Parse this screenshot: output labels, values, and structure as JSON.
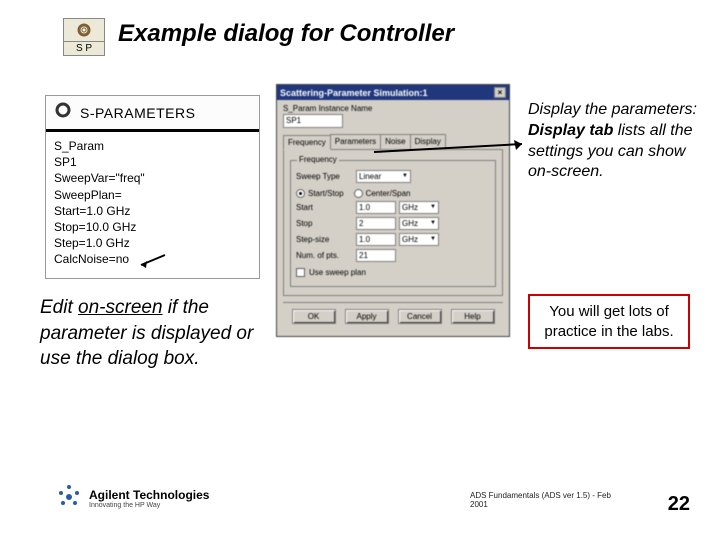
{
  "sp_icon": {
    "label": "S P"
  },
  "title": "Example dialog for Controller",
  "sparam_block": {
    "header": "S-PARAMETERS",
    "lines": [
      "S_Param",
      "SP1",
      "SweepVar=\"freq\"",
      "SweepPlan=",
      "Start=1.0 GHz",
      "Stop=10.0 GHz",
      "Step=1.0 GHz",
      "CalcNoise=no"
    ]
  },
  "dialog": {
    "title": "Scattering-Parameter Simulation:1",
    "instance_label": "S_Param Instance Name",
    "instance_value": "SP1",
    "tabs": [
      "Frequency",
      "Parameters",
      "Noise",
      "Display"
    ],
    "active_tab": 0,
    "frequency_group": "Frequency",
    "sweep_type_label": "Sweep Type",
    "sweep_type_value": "Linear",
    "radio_startstop": "Start/Stop",
    "radio_centerspan": "Center/Span",
    "rows": {
      "start": {
        "label": "Start",
        "value": "1.0",
        "unit": "GHz"
      },
      "stop": {
        "label": "Stop",
        "value": "2",
        "unit": "GHz"
      },
      "stepsize": {
        "label": "Step-size",
        "value": "1.0",
        "unit": "GHz"
      },
      "numpts": {
        "label": "Num. of pts.",
        "value": "21"
      }
    },
    "use_sweep_plan": "Use sweep plan",
    "buttons": {
      "ok": "OK",
      "apply": "Apply",
      "cancel": "Cancel",
      "help": "Help"
    }
  },
  "left_callout": {
    "pre": "Edit ",
    "underlined": "on-screen",
    "post": " if the parameter is displayed or use the dialog box."
  },
  "right_callout": {
    "line1": "Display the parameters:",
    "bold": "Display tab",
    "rest": " lists all the settings you can show on-screen."
  },
  "practice_box": "You will get lots of practice in the labs.",
  "footer": {
    "agilent_main": "Agilent Technologies",
    "agilent_sub": "Innovating the HP Way",
    "note": "ADS Fundamentals (ADS ver 1.5) - Feb 2001",
    "page": "22"
  }
}
